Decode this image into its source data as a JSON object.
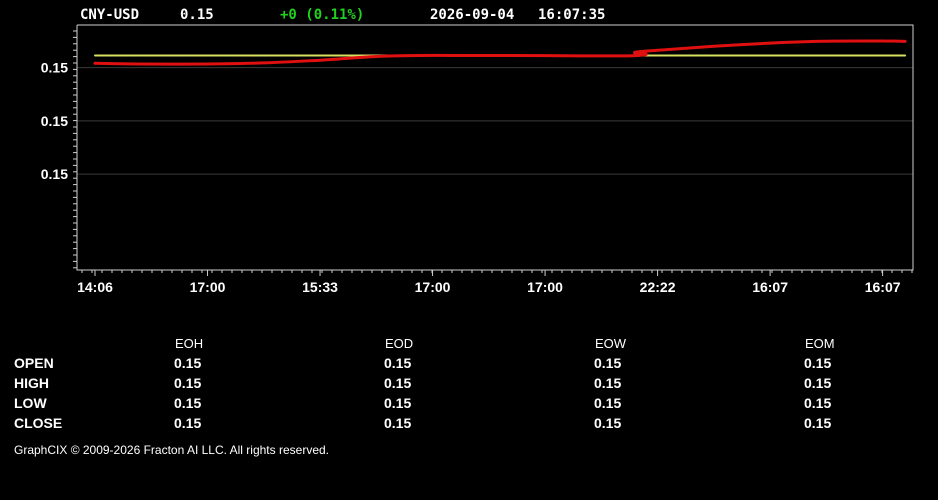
{
  "header": {
    "symbol": "CNY-USD",
    "price": "0.15",
    "change": "+0 (0.11%)",
    "date": "2026-09-04",
    "time": "16:07:35"
  },
  "colors": {
    "background": "#000000",
    "price_line": "#e01010",
    "reference_line": "#d8e060",
    "change_text": "#1fd21f",
    "gridline": "#3a3a3a"
  },
  "chart_data": {
    "type": "line",
    "title": "",
    "xlabel": "",
    "ylabel": "",
    "ylim": [
      0.14955,
      0.1507
    ],
    "y_ticks": [
      0.15,
      0.15025,
      0.1505
    ],
    "y_tick_labels": [
      "0.15",
      "0.15",
      "0.15"
    ],
    "x": [
      0,
      1,
      2,
      3,
      4,
      5,
      6,
      7
    ],
    "x_tick_labels": [
      "14:06",
      "17:00",
      "15:33",
      "17:00",
      "17:00",
      "22:22",
      "16:07",
      "16:07"
    ],
    "xlim": [
      -0.16,
      7.27
    ],
    "grid": true,
    "series": [
      {
        "kind": "price",
        "color": "#e01010",
        "points": [
          [
            0.0,
            0.15052
          ],
          [
            0.4,
            0.150517
          ],
          [
            1.0,
            0.150517
          ],
          [
            1.5,
            0.150522
          ],
          [
            2.0,
            0.150535
          ],
          [
            2.5,
            0.150552
          ],
          [
            2.9,
            0.150557
          ],
          [
            3.3,
            0.150557
          ],
          [
            3.7,
            0.150557
          ],
          [
            4.3,
            0.150555
          ],
          [
            4.7,
            0.150555
          ],
          [
            4.83,
            0.150557
          ],
          [
            4.9,
            0.150563
          ],
          [
            4.8,
            0.150572
          ],
          [
            5.1,
            0.150585
          ],
          [
            5.5,
            0.1506
          ],
          [
            6.0,
            0.150615
          ],
          [
            6.4,
            0.150623
          ],
          [
            6.8,
            0.150625
          ],
          [
            7.0,
            0.150625
          ],
          [
            7.2,
            0.150623
          ]
        ]
      },
      {
        "kind": "reference",
        "color": "#d8e060",
        "points": [
          [
            0.0,
            0.150557
          ],
          [
            7.2,
            0.150557
          ]
        ]
      }
    ]
  },
  "summary": {
    "columns": [
      "EOH",
      "EOD",
      "EOW",
      "EOM"
    ],
    "rows": [
      {
        "label": "OPEN",
        "values": [
          "0.15",
          "0.15",
          "0.15",
          "0.15"
        ]
      },
      {
        "label": "HIGH",
        "values": [
          "0.15",
          "0.15",
          "0.15",
          "0.15"
        ]
      },
      {
        "label": "LOW",
        "values": [
          "0.15",
          "0.15",
          "0.15",
          "0.15"
        ]
      },
      {
        "label": "CLOSE",
        "values": [
          "0.15",
          "0.15",
          "0.15",
          "0.15"
        ]
      }
    ]
  },
  "footer": "GraphCIX © 2009-2026 Fracton AI LLC. All rights reserved."
}
